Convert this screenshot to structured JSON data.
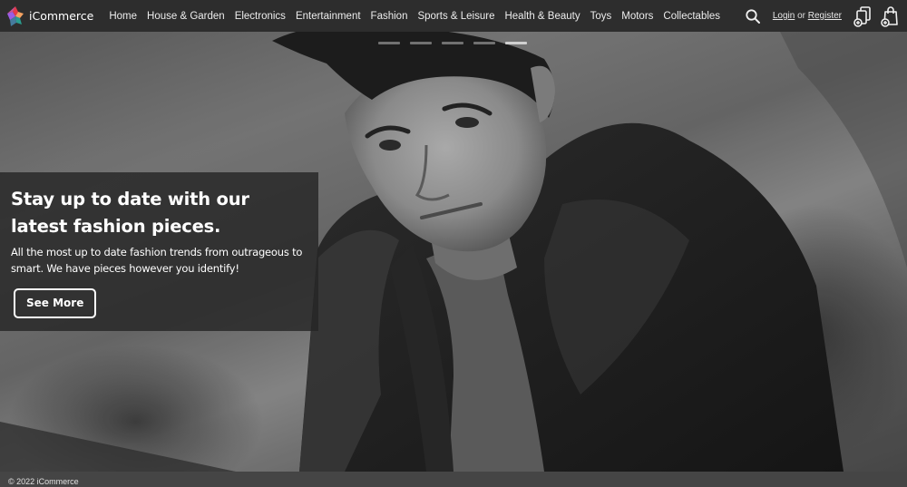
{
  "brand": {
    "name": "iCommerce"
  },
  "nav": {
    "items": [
      {
        "label": "Home"
      },
      {
        "label": "House & Garden"
      },
      {
        "label": "Electronics"
      },
      {
        "label": "Entertainment"
      },
      {
        "label": "Fashion"
      },
      {
        "label": "Sports & Leisure"
      },
      {
        "label": "Health & Beauty"
      },
      {
        "label": "Toys"
      },
      {
        "label": "Motors"
      },
      {
        "label": "Collectables"
      }
    ]
  },
  "header": {
    "search_icon": "search-icon",
    "login_label": "Login",
    "or_label": "or",
    "register_label": "Register",
    "compare_icon": "compare-icon",
    "cart_icon": "shopping-bag-icon"
  },
  "hero": {
    "slide_count": 5,
    "active_slide": 5,
    "title": "Stay up to date with our latest fashion pieces.",
    "text": "All the most up to date fashion trends from outrageous to smart. We have pieces however you identify!",
    "button_label": "See More"
  },
  "footer": {
    "copyright": "© 2022 iCommerce"
  },
  "colors": {
    "topbar_bg": "#2d2d2d",
    "footer_bg": "#454545",
    "caption_bg": "#262626",
    "text": "#ffffff"
  }
}
